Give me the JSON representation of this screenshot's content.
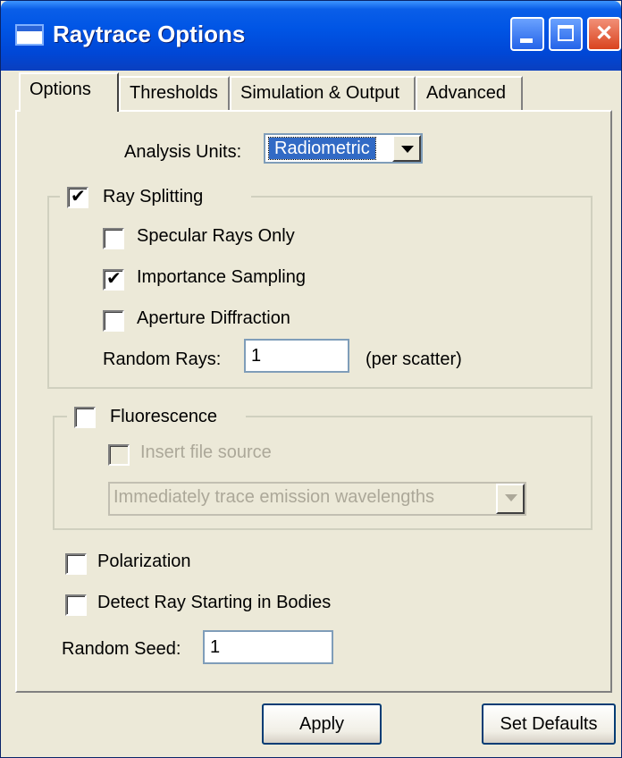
{
  "window": {
    "title": "Raytrace Options"
  },
  "tabs": [
    {
      "label": "Options"
    },
    {
      "label": "Thresholds"
    },
    {
      "label": "Simulation & Output"
    },
    {
      "label": "Advanced"
    }
  ],
  "options": {
    "analysis_units_label": "Analysis Units:",
    "analysis_units_value": "Radiometric",
    "ray_splitting": {
      "label": "Ray Splitting",
      "checked": true,
      "specular_rays_only": {
        "label": "Specular Rays Only",
        "checked": false
      },
      "importance_sampling": {
        "label": "Importance Sampling",
        "checked": true
      },
      "aperture_diffraction": {
        "label": "Aperture Diffraction",
        "checked": false
      },
      "random_rays_label": "Random Rays:",
      "random_rays_value": "1",
      "random_rays_suffix": "(per scatter)"
    },
    "fluorescence": {
      "label": "Fluorescence",
      "checked": false,
      "insert_file_source": {
        "label": "Insert file source",
        "checked": false
      },
      "trace_mode_value": "Immediately trace emission wavelengths"
    },
    "polarization": {
      "label": "Polarization",
      "checked": false
    },
    "detect_ray_starting": {
      "label": "Detect Ray Starting in Bodies",
      "checked": false
    },
    "random_seed_label": "Random Seed:",
    "random_seed_value": "1"
  },
  "buttons": {
    "apply_label": "Apply",
    "set_defaults_label": "Set Defaults"
  }
}
